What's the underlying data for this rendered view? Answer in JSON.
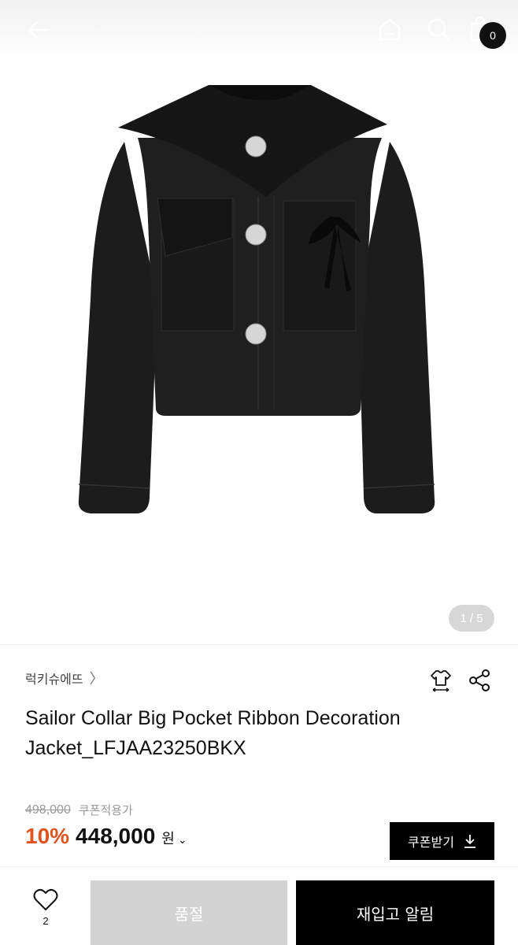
{
  "header": {
    "icons": [
      "back-arrow-icon",
      "home-icon",
      "search-icon",
      "shopping-bag-icon"
    ],
    "cart_count": "0"
  },
  "gallery": {
    "image_desc_icon": "black-sailor-collar-jacket",
    "pager": "1 / 5"
  },
  "product": {
    "brand": "럭키슈에뜨",
    "brand_chevron": "〉",
    "title": "Sailor Collar Big Pocket Ribbon Decoration Jacket_LFJAA23250BKX",
    "original_price": "498,000",
    "coupon_applied_label": "쿠폰적용가",
    "discount": "10%",
    "price": "448,000",
    "currency": "원",
    "currency_chevron": "⌄",
    "coupon_button": "쿠폰받기"
  },
  "bottom_bar": {
    "like_count": "2",
    "soldout_label": "품절",
    "restock_label": "재입고 알림"
  },
  "colors": {
    "discount": "#e0531f",
    "primary_button": "#000000",
    "disabled_button": "#d3d3d3"
  }
}
